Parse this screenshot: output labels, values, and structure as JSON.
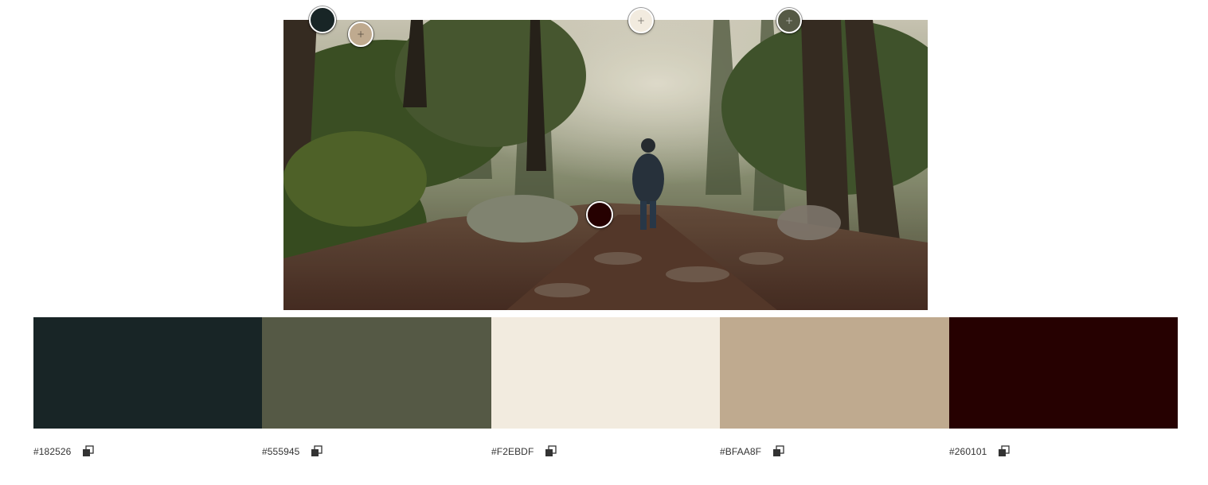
{
  "image": {
    "alt_semantic": "forest-trail-photo"
  },
  "palette": [
    {
      "hex": "#182526"
    },
    {
      "hex": "#555945"
    },
    {
      "hex": "#F2EBDF"
    },
    {
      "hex": "#BFAA8F"
    },
    {
      "hex": "#260101"
    }
  ],
  "icons": {
    "copy": "copy-icon",
    "add": "plus-icon"
  }
}
